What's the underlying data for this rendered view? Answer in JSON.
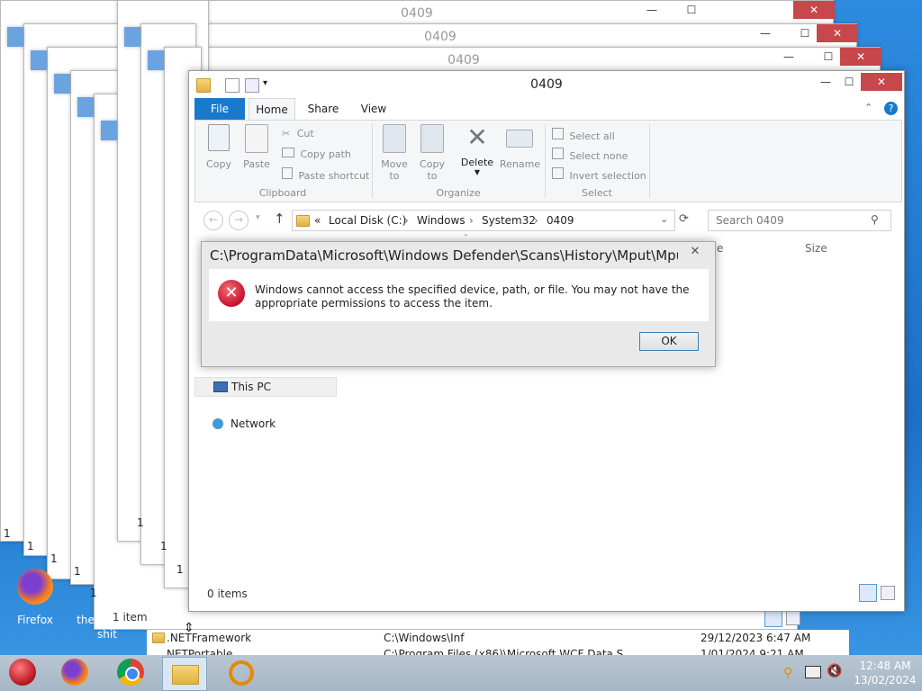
{
  "window": {
    "title": "0409",
    "bg_title": "0409",
    "tabs": [
      "File",
      "Home",
      "Share",
      "View"
    ],
    "ribbon": {
      "clipboard": {
        "copy": "Copy",
        "paste": "Paste",
        "cut": "Cut",
        "copy_path": "Copy path",
        "paste_shortcut": "Paste shortcut",
        "label": "Clipboard"
      },
      "organize": {
        "move_to": "Move",
        "move_to2": "to",
        "copy_to": "Copy",
        "copy_to2": "to",
        "delete": "Delete",
        "rename": "Rename",
        "label": "Organize"
      },
      "select": {
        "select_all": "Select all",
        "select_none": "Select none",
        "invert": "Invert selection",
        "label": "Select"
      }
    },
    "address": [
      "«",
      "Local Disk (C:)",
      "Windows",
      "System32",
      "0409"
    ],
    "search_placeholder": "Search 0409",
    "columns": {
      "size": "Size",
      "partial": "e"
    },
    "nav": {
      "this_pc": "This PC",
      "network": "Network"
    },
    "status": "0 items",
    "back_status": "1 item"
  },
  "dialog": {
    "title": "C:\\ProgramData\\Microsoft\\Windows Defender\\Scans\\History\\Mput\\MputHist...",
    "message": "Windows cannot access the specified device, path, or file. You may not have the appropriate permissions to access the item.",
    "ok": "OK",
    "close": "✕"
  },
  "list_rows": [
    {
      "name": ".NETFramework",
      "path": "C:\\Windows\\Inf",
      "date": "29/12/2023 6:47 AM"
    },
    {
      "name": "NETPortable",
      "path": "C:\\Program Files (x86)\\Microsoft WCF Data S...",
      "date": "1/01/2024 9:21 AM"
    }
  ],
  "desktop": {
    "firefox": "Firefox",
    "other": "the",
    "other2": "shit"
  },
  "tray": {
    "time": "12:48 AM",
    "date": "13/02/2024"
  },
  "bg_windows": [
    "0409",
    "0409",
    "0409"
  ],
  "bg_digits": [
    "1",
    "1",
    "1",
    "1",
    "1",
    "1",
    "1",
    "1",
    "1"
  ],
  "colors": {
    "accent": "#1979ca",
    "close": "#c7474b",
    "error": "#c8102e"
  }
}
